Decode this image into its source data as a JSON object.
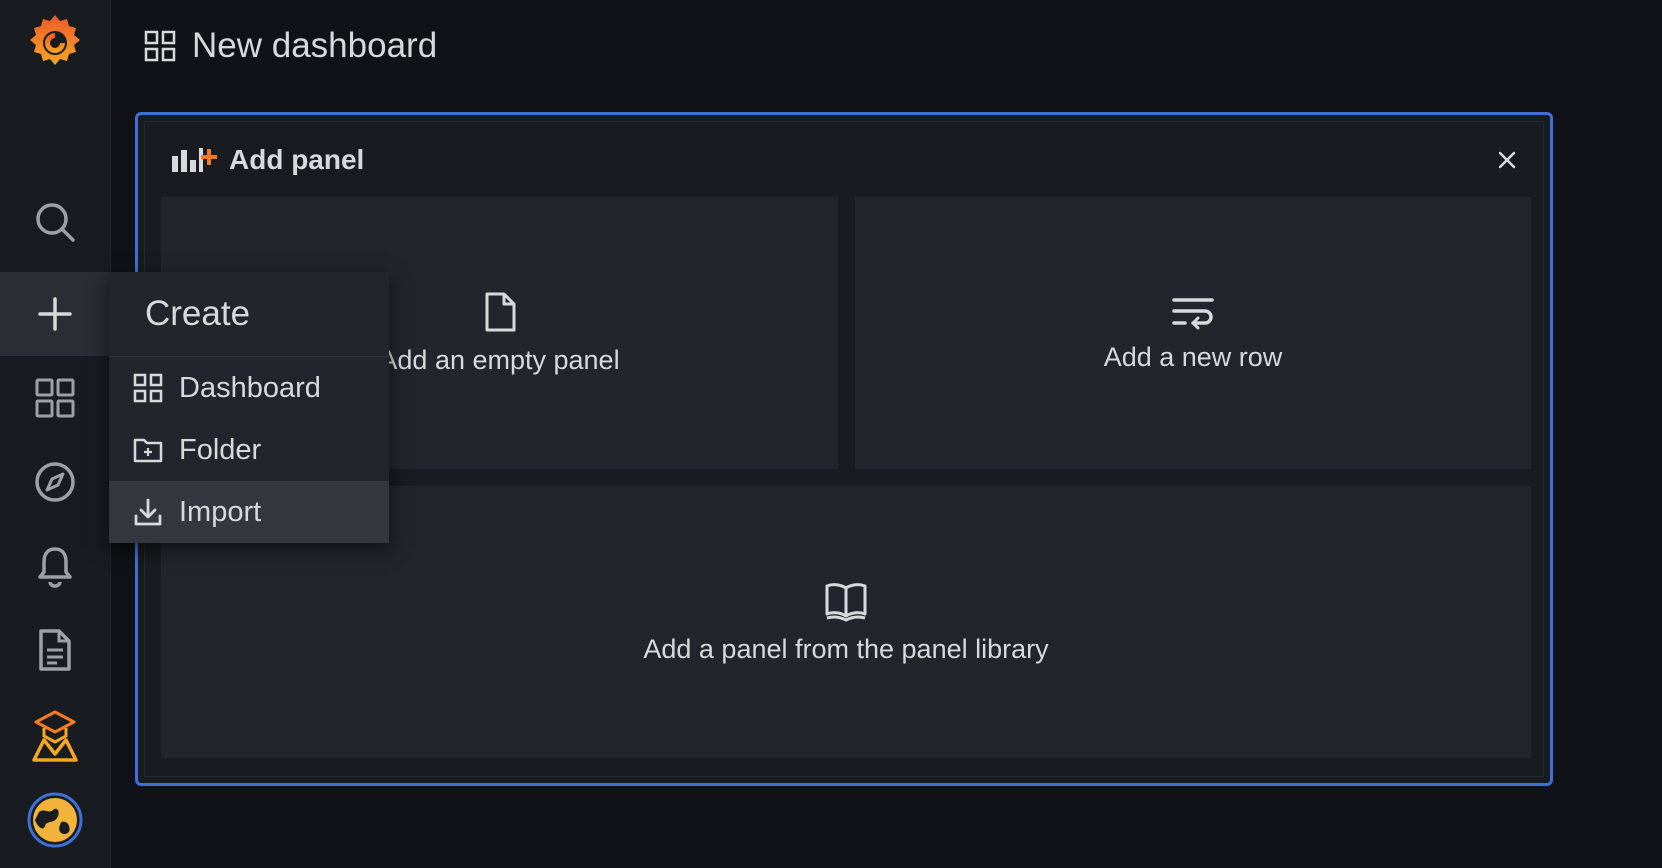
{
  "header": {
    "title": "New dashboard",
    "icon": "dashboard-grid-icon"
  },
  "sidebar": {
    "logo": "grafana-logo-icon",
    "items": [
      {
        "icon": "search-icon"
      },
      {
        "icon": "plus-icon",
        "active": true
      },
      {
        "icon": "dashboards-icon"
      },
      {
        "icon": "compass-icon"
      },
      {
        "icon": "bell-icon"
      },
      {
        "icon": "document-icon"
      },
      {
        "icon": "plugin-app-icon"
      },
      {
        "icon": "globe-avatar-icon"
      }
    ]
  },
  "create_menu": {
    "title": "Create",
    "items": [
      {
        "label": "Dashboard",
        "icon": "dashboard-grid-icon"
      },
      {
        "label": "Folder",
        "icon": "folder-plus-icon"
      },
      {
        "label": "Import",
        "icon": "import-icon"
      }
    ]
  },
  "add_panel": {
    "title": "Add panel",
    "icon": "add-panel-icon",
    "options": [
      {
        "label": "Add an empty panel",
        "icon": "file-icon"
      },
      {
        "label": "Add a new row",
        "icon": "wrap-lines-icon"
      },
      {
        "label": "Add a panel from the panel library",
        "icon": "book-icon"
      }
    ]
  },
  "colors": {
    "background": "#111217",
    "sidebar": "#181b1f",
    "accent_blue": "#3d71d9",
    "grafana_orange": "#f47a24"
  }
}
